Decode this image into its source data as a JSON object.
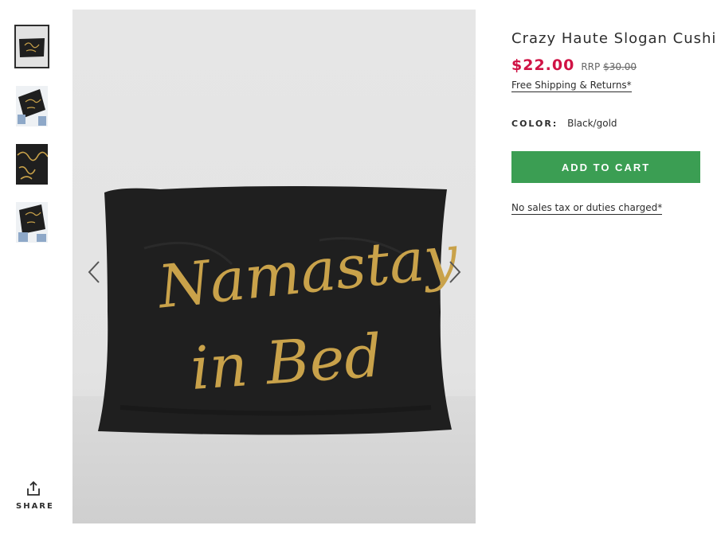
{
  "product": {
    "title": "Crazy Haute Slogan Cushion",
    "price": "$22.00",
    "rrp_label": "RRP",
    "rrp_price": "$30.00",
    "shipping_link": "Free Shipping & Returns*",
    "color_label": "COLOR:",
    "color_value": "Black/gold",
    "add_to_cart": "ADD TO CART",
    "tax_note": "No sales tax or duties charged*"
  },
  "gallery": {
    "slogan_line1": "Namastay",
    "slogan_line2": "in Bed",
    "thumbnails": [
      "thumbnail-1",
      "thumbnail-2",
      "thumbnail-3",
      "thumbnail-4"
    ],
    "active_thumbnail": 1
  },
  "share": {
    "label": "SHARE",
    "icon": "share-icon"
  },
  "icons": {
    "prev": "chevron-left-icon",
    "next": "chevron-right-icon"
  },
  "colors": {
    "price": "#d01345",
    "cart_button": "#3b9e53",
    "text": "#2d2d2d",
    "pillow": "#1f1f1f",
    "gold": "#c9a24a"
  }
}
